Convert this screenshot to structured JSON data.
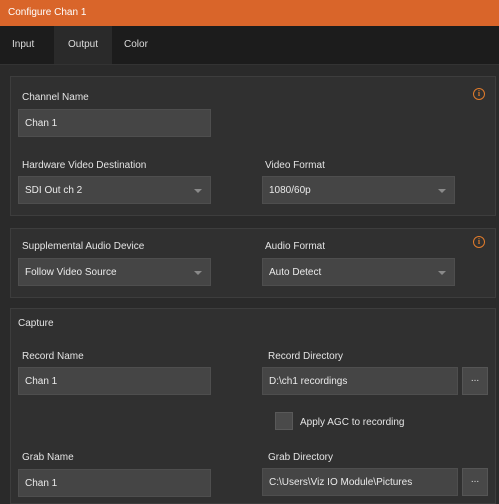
{
  "window": {
    "title": "Configure Chan 1"
  },
  "tabs": [
    {
      "label": "Input"
    },
    {
      "label": "Output"
    },
    {
      "label": "Color"
    }
  ],
  "output_section": {
    "channel_name_label": "Channel Name",
    "channel_name_value": "Chan 1",
    "hw_video_dest_label": "Hardware Video Destination",
    "hw_video_dest_value": "SDI Out ch 2",
    "video_format_label": "Video Format",
    "video_format_value": "1080/60p",
    "info_icon": "i"
  },
  "audio_section": {
    "supp_audio_label": "Supplemental Audio Device",
    "supp_audio_value": "Follow Video Source",
    "audio_format_label": "Audio Format",
    "audio_format_value": "Auto Detect",
    "info_icon": "i"
  },
  "capture_section": {
    "title": "Capture",
    "record_name_label": "Record Name",
    "record_name_value": "Chan 1",
    "record_dir_label": "Record Directory",
    "record_dir_value": "D:\\ch1 recordings",
    "browse_label": "...",
    "agc_label": "Apply AGC to recording",
    "grab_name_label": "Grab Name",
    "grab_name_value": "Chan 1",
    "grab_dir_label": "Grab Directory",
    "grab_dir_value": "C:\\Users\\Viz IO Module\\Pictures"
  },
  "colors": {
    "titlebar": "#d9652a",
    "info_accent": "#e07b2b"
  }
}
